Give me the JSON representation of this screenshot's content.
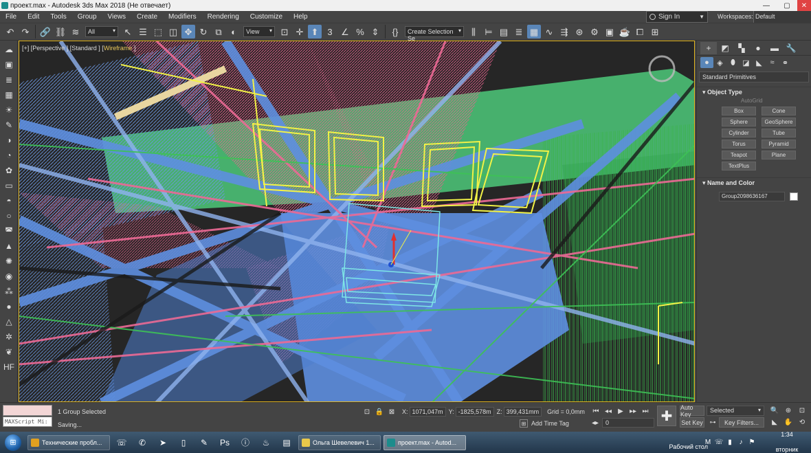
{
  "window": {
    "title": "проект.max - Autodesk 3ds Max 2018  (Не отвечает)",
    "minimize": "—",
    "maximize": "▢",
    "close": "✕"
  },
  "menu": {
    "items": [
      "File",
      "Edit",
      "Tools",
      "Group",
      "Views",
      "Create",
      "Modifiers",
      "Rendering",
      "Customize",
      "Help"
    ],
    "signin": "Sign In",
    "workspaces_label": "Workspaces:",
    "workspaces_value": "Default"
  },
  "toolbar": {
    "filter": "All",
    "refcoord": "View",
    "selection_set": "Create Selection Se"
  },
  "viewport": {
    "label_prefix": "[+] [Perspective ] [Standard ] [",
    "label_mode": "Wireframe",
    "label_suffix": " ]"
  },
  "command_panel": {
    "category": "Standard Primitives",
    "object_type_title": "Object Type",
    "autogrid": "AutoGrid",
    "primitives": [
      "Box",
      "Cone",
      "Sphere",
      "GeoSphere",
      "Cylinder",
      "Tube",
      "Torus",
      "Pyramid",
      "Teapot",
      "Plane",
      "TextPlus"
    ],
    "name_color_title": "Name and Color",
    "object_name": "Group2098636167",
    "object_color": "#ffffff"
  },
  "status": {
    "maxscript": "MAXScript Mi:",
    "selection": "1 Group Selected",
    "message": "Saving...",
    "x_label": "X:",
    "x_value": "1071,047m",
    "y_label": "Y:",
    "y_value": "-1825,578m",
    "z_label": "Z:",
    "z_value": "399,431mm",
    "grid": "Grid = 0,0mm",
    "add_time_tag": "Add Time Tag",
    "frame_value": "0",
    "auto_key": "Auto Key",
    "set_key": "Set Key",
    "key_selection": "Selected",
    "key_filters": "Key Filters..."
  },
  "taskbar": {
    "tasks": [
      {
        "label": "Технические пробл...",
        "color": "#e0a020"
      },
      {
        "label": "Ольга Шевелевич 1...",
        "color": "#e8c84a"
      },
      {
        "label": "проект.max - Autod...",
        "color": "#1c8c8c"
      }
    ],
    "desktop": "Рабочий стол",
    "time": "1:34",
    "day": "вторник"
  }
}
